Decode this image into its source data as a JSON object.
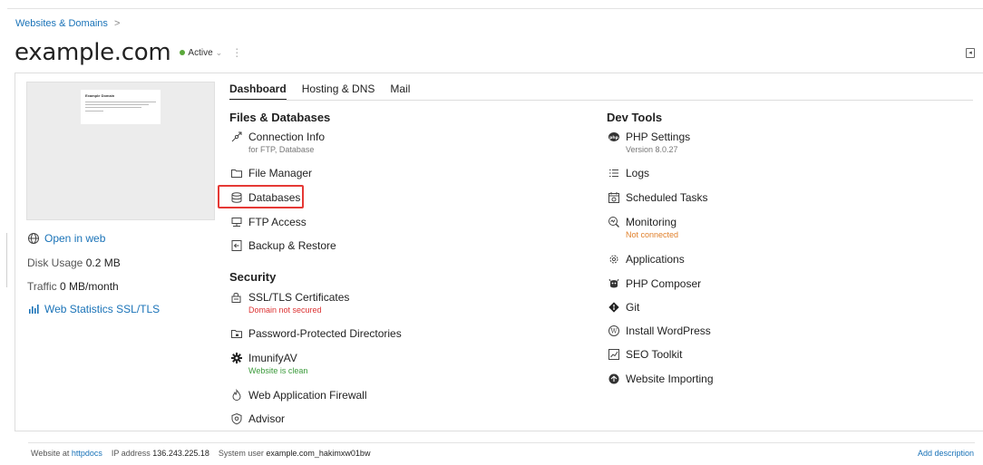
{
  "breadcrumb": {
    "label": "Websites & Domains",
    "sep": ">"
  },
  "domain": {
    "name": "example.com",
    "status": "Active"
  },
  "thumbnail": {
    "heading": "Example Domain"
  },
  "sidebar": {
    "open_in_web": "Open in web",
    "disk_usage_label": "Disk Usage",
    "disk_usage_value": "0.2 MB",
    "traffic_label": "Traffic",
    "traffic_value": "0 MB/month",
    "web_statistics": "Web Statistics SSL/TLS"
  },
  "tabs": [
    "Dashboard",
    "Hosting & DNS",
    "Mail"
  ],
  "files_db": {
    "title": "Files & Databases",
    "connection_info": "Connection Info",
    "connection_info_sub": "for FTP, Database",
    "file_manager": "File Manager",
    "databases": "Databases",
    "ftp_access": "FTP Access",
    "backup_restore": "Backup & Restore"
  },
  "security": {
    "title": "Security",
    "ssl": "SSL/TLS Certificates",
    "ssl_sub": "Domain not secured",
    "password_dirs": "Password-Protected Directories",
    "imunify": "ImunifyAV",
    "imunify_sub": "Website is clean",
    "waf": "Web Application Firewall",
    "advisor": "Advisor"
  },
  "dev_tools": {
    "title": "Dev Tools",
    "php_settings": "PHP Settings",
    "php_version": "Version 8.0.27",
    "logs": "Logs",
    "scheduled_tasks": "Scheduled Tasks",
    "monitoring": "Monitoring",
    "monitoring_sub": "Not connected",
    "applications": "Applications",
    "php_composer": "PHP Composer",
    "git": "Git",
    "install_wordpress": "Install WordPress",
    "seo_toolkit": "SEO Toolkit",
    "website_importing": "Website Importing"
  },
  "footer": {
    "website_at_label": "Website at",
    "website_at_link": "httpdocs",
    "ip_label": "IP address",
    "ip_value": "136.243.225.18",
    "sysuser_label": "System user",
    "sysuser_value": "example.com_hakimxw01bw",
    "add_description": "Add description"
  },
  "colors": {
    "link": "#1a73b8",
    "active_dot": "#5aa83a",
    "highlight": "#e53935",
    "error": "#d33333",
    "warning": "#e0802b",
    "success": "#3a9a3a"
  }
}
